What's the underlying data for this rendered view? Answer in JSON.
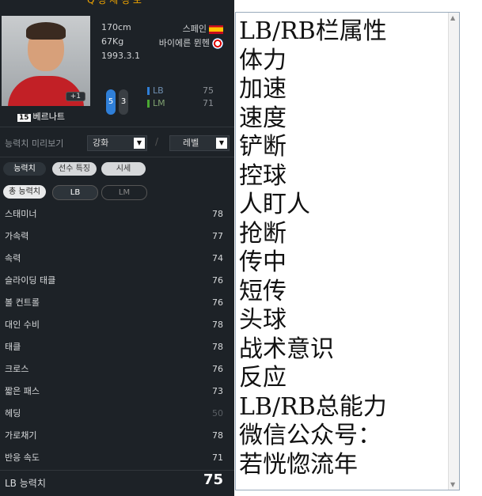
{
  "player": {
    "top_name": "Q 성 세 정 보",
    "height": "170cm",
    "weight": "67Kg",
    "birth": "1993.3.1",
    "nation": "스페인",
    "club": "바이에른 뮌헨",
    "number": "15",
    "name": "베르나트",
    "plus": "+1",
    "left_foot": "5",
    "right_foot": "3"
  },
  "positions": [
    {
      "pos": "LB",
      "value": "75",
      "color": "#2f7fd8"
    },
    {
      "pos": "LM",
      "value": "71",
      "color": "#4aa832"
    }
  ],
  "controls": {
    "preview_label": "능력치 미리보기",
    "enhance": "강화",
    "level": "레벨",
    "slash": "/"
  },
  "tabs": {
    "stats": "능력치",
    "traits": "선수 특징",
    "market": "시세",
    "total": "총 능력치",
    "lb": "LB",
    "lm": "LM"
  },
  "stats": [
    {
      "label": "스태미너",
      "value": "78"
    },
    {
      "label": "가속력",
      "value": "77"
    },
    {
      "label": "속력",
      "value": "74"
    },
    {
      "label": "슬라이딩 태클",
      "value": "76"
    },
    {
      "label": "볼 컨트롤",
      "value": "76"
    },
    {
      "label": "대인 수비",
      "value": "78"
    },
    {
      "label": "태클",
      "value": "78"
    },
    {
      "label": "크로스",
      "value": "76"
    },
    {
      "label": "짧은 패스",
      "value": "73"
    },
    {
      "label": "헤딩",
      "value": "50"
    },
    {
      "label": "가로채기",
      "value": "78"
    },
    {
      "label": "반응 속도",
      "value": "71"
    }
  ],
  "total": {
    "label": "LB 능력치",
    "value": "75"
  },
  "notes": [
    "LB/RB栏属性",
    "体力",
    "加速",
    "速度",
    "铲断",
    "控球",
    "人盯人",
    "抢断",
    "传中",
    "短传",
    "头球",
    "战术意识",
    "反应",
    "LB/RB总能力",
    "微信公众号：",
    "若恍惚流年"
  ],
  "colors": {
    "panel": "#1d2227",
    "accent": "#f0a500",
    "muted_stat": "#5a5f64"
  }
}
